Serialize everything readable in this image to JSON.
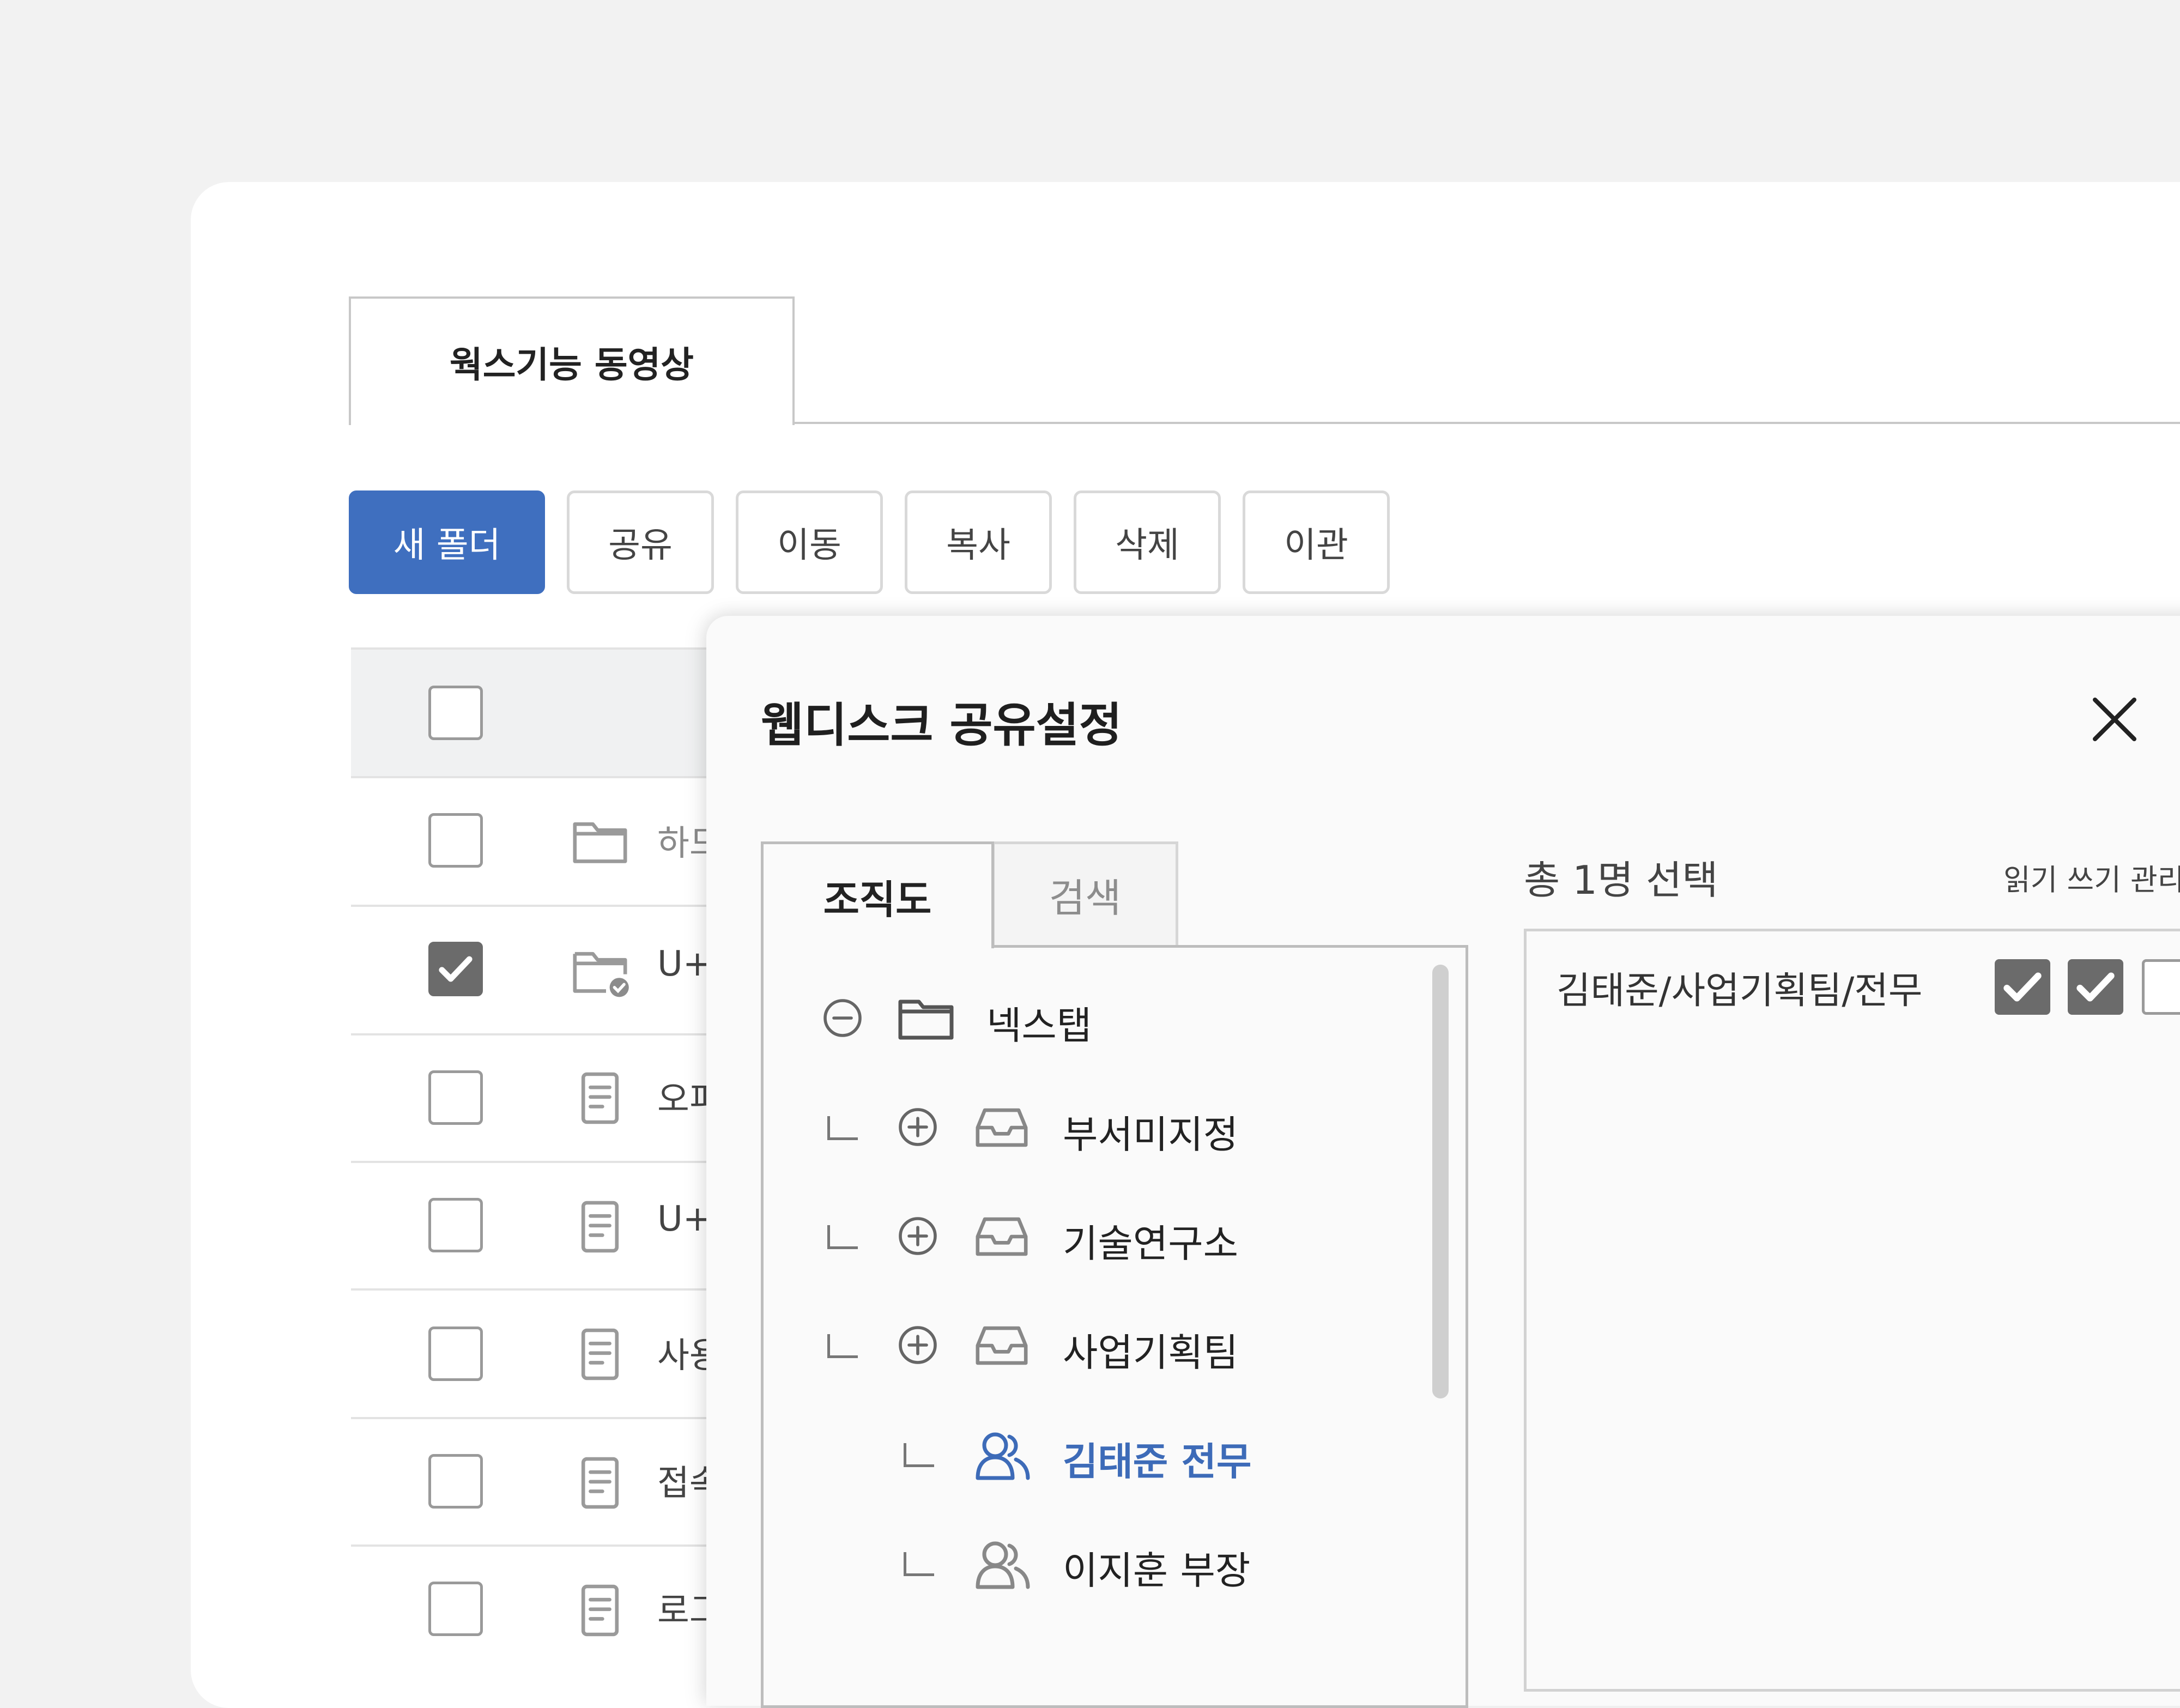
{
  "page_tab": {
    "label": "웍스기능 동영상"
  },
  "toolbar": {
    "new_folder": "새 폴더",
    "share": "공유",
    "move": "이동",
    "copy": "복사",
    "delete": "삭제",
    "transfer": "이관"
  },
  "file_list": {
    "rows": [
      {
        "name": "하드",
        "icon": "folder-icon",
        "checked": false
      },
      {
        "name": "U+",
        "icon": "shared-folder-icon",
        "checked": true
      },
      {
        "name": "오피",
        "icon": "document-icon",
        "checked": false
      },
      {
        "name": "U+",
        "icon": "document-icon",
        "checked": false
      },
      {
        "name": "사용",
        "icon": "document-icon",
        "checked": false
      },
      {
        "name": "접속",
        "icon": "document-icon",
        "checked": false
      },
      {
        "name": "로그",
        "icon": "document-icon",
        "checked": false
      }
    ]
  },
  "dialog": {
    "title": "웹디스크 공유설정",
    "tabs": {
      "org_chart": "조직도",
      "search": "검색"
    },
    "tree": {
      "root": "넥스탭",
      "departments": [
        "부서미지정",
        "기술연구소",
        "사업기획팀"
      ],
      "members": [
        "김태준 전무",
        "이지훈 부장"
      ]
    },
    "selection": {
      "count_label": "총 1명 선택",
      "permission_headers": "읽기 쓰기 관리",
      "selected_name": "김태준/사업기획팀/전무",
      "permissions": {
        "read": true,
        "write": true,
        "manage": false
      }
    }
  },
  "colors": {
    "primary": "#3f6fbf",
    "selected_text": "#3d6bb8",
    "checked_box": "#6b6b6b"
  }
}
